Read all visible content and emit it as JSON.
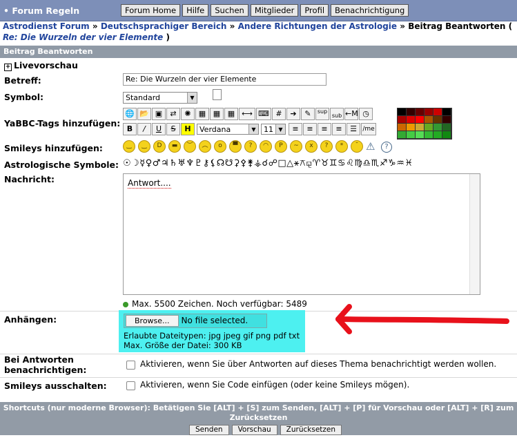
{
  "header": {
    "brand": "• Forum Regeln",
    "menu": [
      "Forum Home",
      "Hilfe",
      "Suchen",
      "Mitglieder",
      "Profil",
      "Benachrichtigung"
    ]
  },
  "breadcrumb": {
    "items": [
      "Astrodienst Forum",
      "Deutschsprachiger Bereich",
      "Andere Richtungen der Astrologie"
    ],
    "separator": "»",
    "current": "Beitrag Beantworten (",
    "topic": "Re: Die Wurzeln der vier Elemente",
    "close": ")"
  },
  "section_title": "Beitrag Beantworten",
  "live_preview": "Livevorschau",
  "form": {
    "subject_label": "Betreff:",
    "subject_value": "Re: Die Wurzeln der vier Elemente",
    "symbol_label": "Symbol:",
    "symbol_value": "Standard",
    "yabbc_label": "YaBBC-Tags hinzufügen:",
    "font_value": "Verdana",
    "size_value": "11",
    "smileys_label": "Smileys hinzufügen:",
    "astro_label": "Astrologische Symbole:",
    "astro_symbols": "☉☽☿♀♂♃♄♅♆♇⚷⚸☊☋⚳⚴⚵⚶☌☍□△⚹⚻⚼♈♉♊♋♌♍♎♏♐♑♒♓",
    "message_label": "Nachricht:",
    "message_value": "Antwort....",
    "chars_text": "Max. 5500 Zeichen. Noch verfügbar:",
    "chars_remaining": "5489",
    "attach_label": "Anhängen:",
    "browse_label": "Browse...",
    "no_file": "No file selected.",
    "allowed_types": "Erlaubte Dateitypen: jpg jpeg gif png pdf txt",
    "max_size": "Max. Größe der Datei: 300 KB",
    "notify_label": "Bei Antworten benachrichtigen:",
    "notify_text": "Aktivieren, wenn Sie über Antworten auf dieses Thema benachrichtigt werden wollen.",
    "nosmiley_label": "Smileys ausschalten:",
    "nosmiley_text": "Aktivieren, wenn Sie Code einfügen (oder keine Smileys mögen)."
  },
  "footer": {
    "shortcuts": "Shortcuts (nur moderne Browser): Betätigen Sie [ALT] + [S] zum Senden, [ALT] + [P] für Vorschau oder [ALT] + [R] zum Zurücksetzen",
    "send": "Senden",
    "preview": "Vorschau",
    "reset": "Zurücksetzen"
  },
  "colors": {
    "header_bg": "#7d8fb8",
    "section_bg": "#909aa6",
    "link": "#20449c",
    "attach_highlight": "#4df0f0",
    "arrow": "#e8111b"
  }
}
